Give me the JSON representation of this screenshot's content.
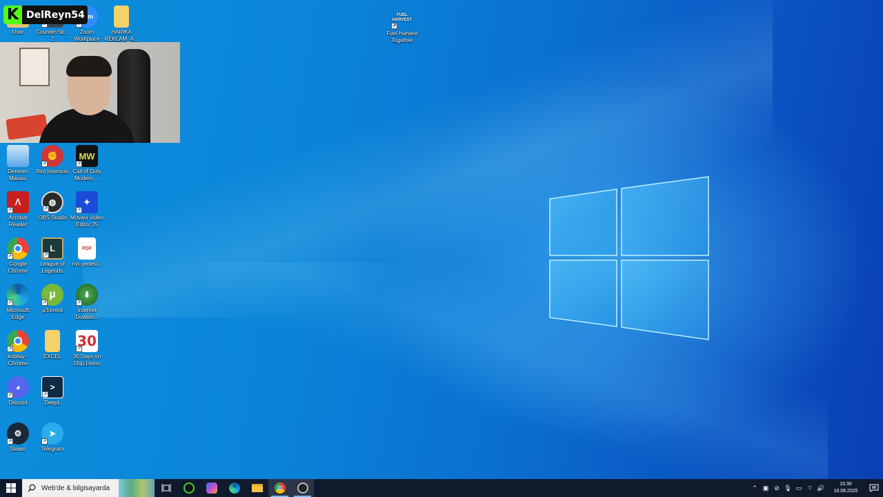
{
  "desktop": {
    "icons": [
      {
        "id": "user",
        "label": "User"
      },
      {
        "id": "counter-strike",
        "label": "Counter-Str... 2"
      },
      {
        "id": "zoom",
        "label": "Zoom Workplace"
      },
      {
        "id": "harika",
        "label": "HARIKA REKLAM_A..."
      },
      {
        "id": "fuel-harvest",
        "label": "Fuel Harvest Together"
      },
      {
        "id": "denetim",
        "label": "Denetim Masası"
      },
      {
        "id": "riot",
        "label": "Riot İstemcisi"
      },
      {
        "id": "cod",
        "label": "Call of Duty Modern ..."
      },
      {
        "id": "acrobat",
        "label": "Acrobat Reader"
      },
      {
        "id": "obs",
        "label": "OBS Studio"
      },
      {
        "id": "movavi",
        "label": "Movavi Video Editor 25"
      },
      {
        "id": "chrome",
        "label": "Google Chrome"
      },
      {
        "id": "lol",
        "label": "League of Legends"
      },
      {
        "id": "pdf",
        "label": "nvi-yerlesi..."
      },
      {
        "id": "edge",
        "label": "Microsoft Edge"
      },
      {
        "id": "utorrent",
        "label": "µTorrent"
      },
      {
        "id": "idm",
        "label": "Internet Downlo..."
      },
      {
        "id": "kubilay",
        "label": "kubilay - Chrome"
      },
      {
        "id": "excel",
        "label": "EXCEL"
      },
      {
        "id": "30days",
        "label": "30 Days on Ship Demo"
      },
      {
        "id": "discord",
        "label": "Discord"
      },
      {
        "id": "deepl",
        "label": "DeepL"
      },
      {
        "id": "steam",
        "label": "Steam"
      },
      {
        "id": "telegram",
        "label": "Telegram"
      }
    ],
    "icon_texts": {
      "cod": "MW",
      "thirty": "30",
      "fuel": "FUEL HARVEST",
      "pdf": "PDF",
      "zoom": "zom"
    }
  },
  "overlay": {
    "streamer_name": "DelReyn54",
    "platform_letter": "K"
  },
  "taskbar": {
    "search_placeholder": "Web'de & bilgisayarda",
    "clock_time": "15:30",
    "clock_date": "18.08.2025"
  }
}
